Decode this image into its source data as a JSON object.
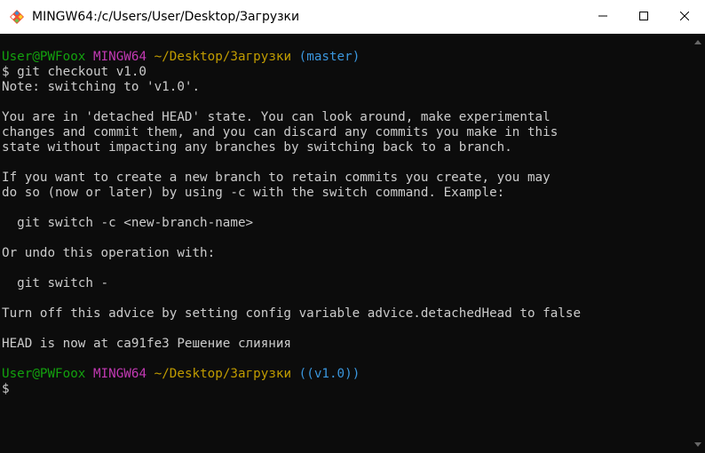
{
  "window": {
    "title": "MINGW64:/c/Users/User/Desktop/Загрузки",
    "icon": "git-bash-icon",
    "controls": {
      "minimize": "minimize-icon",
      "maximize": "maximize-icon",
      "close": "close-icon"
    }
  },
  "colors": {
    "background": "#0c0c0c",
    "text": "#cccccc",
    "prompt_user": "#13a10e",
    "prompt_system": "#c239b3",
    "prompt_path": "#c19c00",
    "prompt_branch": "#3a96dd"
  },
  "terminal": {
    "prompt1": {
      "user": "User@PWFoox",
      "system": "MINGW64",
      "path": "~/Desktop/Загрузки",
      "branch": "(master)"
    },
    "command": "$ git checkout v1.0",
    "output": [
      "Note: switching to 'v1.0'.",
      "You are in 'detached HEAD' state. You can look around, make experimental",
      "changes and commit them, and you can discard any commits you make in this",
      "state without impacting any branches by switching back to a branch.",
      "If you want to create a new branch to retain commits you create, you may",
      "do so (now or later) by using -c with the switch command. Example:",
      "  git switch -c <new-branch-name>",
      "Or undo this operation with:",
      "  git switch -",
      "Turn off this advice by setting config variable advice.detachedHead to false",
      "HEAD is now at ca91fe3 Решение слияния"
    ],
    "prompt2": {
      "user": "User@PWFoox",
      "system": "MINGW64",
      "path": "~/Desktop/Загрузки",
      "branch": "((v1.0))"
    },
    "cursor_prompt": "$"
  }
}
